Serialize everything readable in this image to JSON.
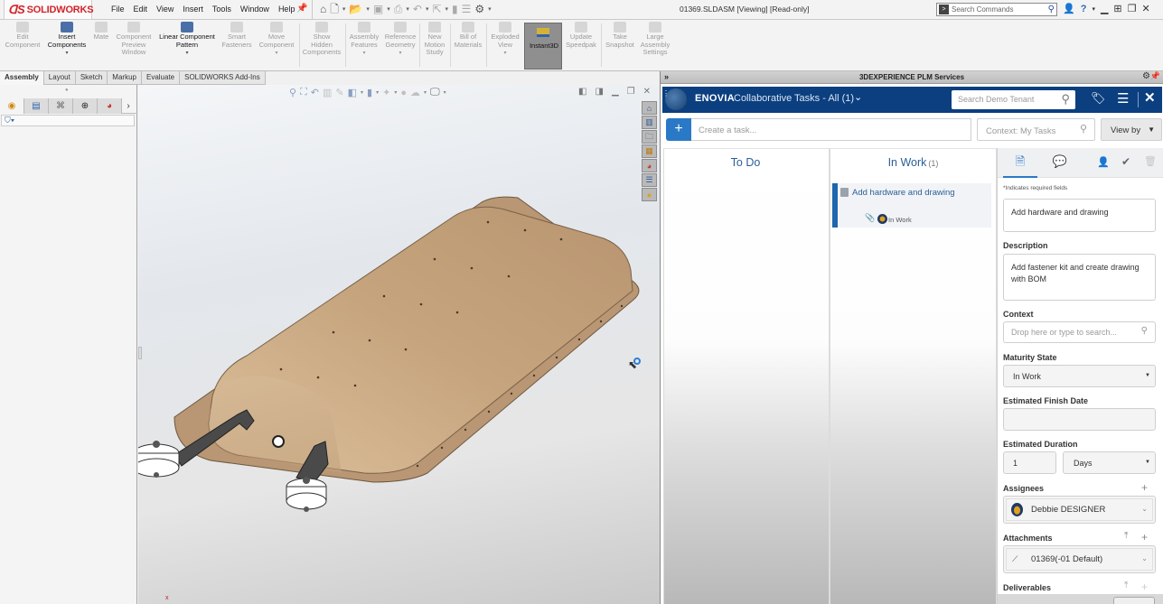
{
  "app": {
    "brand": "SOLIDWORKS",
    "menu": [
      "File",
      "Edit",
      "View",
      "Insert",
      "Tools",
      "Window",
      "Help"
    ],
    "document_title": "01369.SLDASM [Viewing] [Read-only]",
    "search_commands_placeholder": "Search Commands"
  },
  "quick_access": [
    {
      "icon": "home-icon",
      "glyph": "⌂"
    },
    {
      "icon": "new-document-icon",
      "glyph": "🗋"
    },
    {
      "icon": "open-folder-icon",
      "glyph": "📂"
    },
    {
      "icon": "save-icon",
      "glyph": "▣"
    },
    {
      "icon": "print-icon",
      "glyph": "⎙"
    },
    {
      "icon": "undo-icon",
      "glyph": "↶"
    },
    {
      "icon": "select-icon",
      "glyph": "⇱"
    },
    {
      "icon": "rebuild-icon",
      "glyph": "▮"
    },
    {
      "icon": "file-properties-icon",
      "glyph": "☰"
    },
    {
      "icon": "options-gear-icon",
      "glyph": "⚙"
    }
  ],
  "command_manager": [
    {
      "label": "Edit\nComponent",
      "enabled": false,
      "dropdown": false
    },
    {
      "label": "Insert\nComponents",
      "enabled": true,
      "dropdown": true
    },
    {
      "label": "Mate",
      "enabled": false,
      "dropdown": false
    },
    {
      "label": "Component\nPreview\nWindow",
      "enabled": false,
      "dropdown": false
    },
    {
      "label": "Linear Component\nPattern",
      "enabled": true,
      "dropdown": true
    },
    {
      "label": "Smart\nFasteners",
      "enabled": false,
      "dropdown": false
    },
    {
      "label": "Move\nComponent",
      "enabled": false,
      "dropdown": true
    },
    {
      "label": "Show\nHidden\nComponents",
      "enabled": false,
      "dropdown": false
    },
    {
      "label": "Assembly\nFeatures",
      "enabled": false,
      "dropdown": true
    },
    {
      "label": "Reference\nGeometry",
      "enabled": false,
      "dropdown": true
    },
    {
      "label": "New\nMotion\nStudy",
      "enabled": false,
      "dropdown": false
    },
    {
      "label": "Bill of\nMaterials",
      "enabled": false,
      "dropdown": false
    },
    {
      "label": "Exploded\nView",
      "enabled": false,
      "dropdown": true
    },
    {
      "label": "Instant3D",
      "enabled": true,
      "dropdown": false,
      "active": true
    },
    {
      "label": "Update\nSpeedpak",
      "enabled": false,
      "dropdown": false
    },
    {
      "label": "Take\nSnapshot",
      "enabled": false,
      "dropdown": false
    },
    {
      "label": "Large\nAssembly\nSettings",
      "enabled": false,
      "dropdown": false
    }
  ],
  "cm_tabs": [
    "Assembly",
    "Layout",
    "Sketch",
    "Markup",
    "Evaluate",
    "SOLIDWORKS Add-Ins"
  ],
  "cm_active_tab": "Assembly",
  "feature_manager": {
    "tabs": [
      "featuremanager-tree-icon",
      "property-manager-icon",
      "configuration-manager-icon",
      "dimxpert-icon",
      "display-manager-icon"
    ],
    "more": "›",
    "filter_glyph": "⛉▾"
  },
  "viewport": {
    "model": "01369 assembly",
    "cursor_glyph": "⬉"
  },
  "plm_panel": {
    "title": "3DEXPERIENCE PLM Services",
    "enovia_brand": "ENOVIA",
    "app_title": "Collaborative Tasks - All (1)",
    "search_placeholder": "Search Demo Tenant",
    "create_task_placeholder": "Create a task...",
    "context_filter_placeholder": "Context: My Tasks",
    "view_by_label": "View by",
    "columns": [
      {
        "title": "To Do",
        "count": ""
      },
      {
        "title": "In Work",
        "count": "(1)"
      }
    ],
    "task_card": {
      "title": "Add hardware and drawing",
      "state": "In Work",
      "accent_color": "#1e66ae"
    },
    "details": {
      "required_note": "*Indicates required fields",
      "title_value": "Add hardware and drawing",
      "description_label": "Description",
      "description_value": "Add fastener kit and create drawing with BOM",
      "context_label": "Context",
      "context_placeholder": "Drop here or type to search...",
      "maturity_label": "Maturity State",
      "maturity_value": "In Work",
      "finish_label": "Estimated Finish Date",
      "finish_value": "",
      "duration_label": "Estimated Duration",
      "duration_value": "1",
      "duration_unit": "Days",
      "assignees_label": "Assignees",
      "assignee_name": "Debbie DESIGNER",
      "attachments_label": "Attachments",
      "attachment_name": "01369(-01 Default)",
      "deliverables_label": "Deliverables"
    }
  },
  "colors": {
    "enovia_blue": "#0b3f80",
    "accent_blue": "#2a79c6",
    "brand_red": "#d2232a",
    "model_tan": "#c8a77f"
  }
}
